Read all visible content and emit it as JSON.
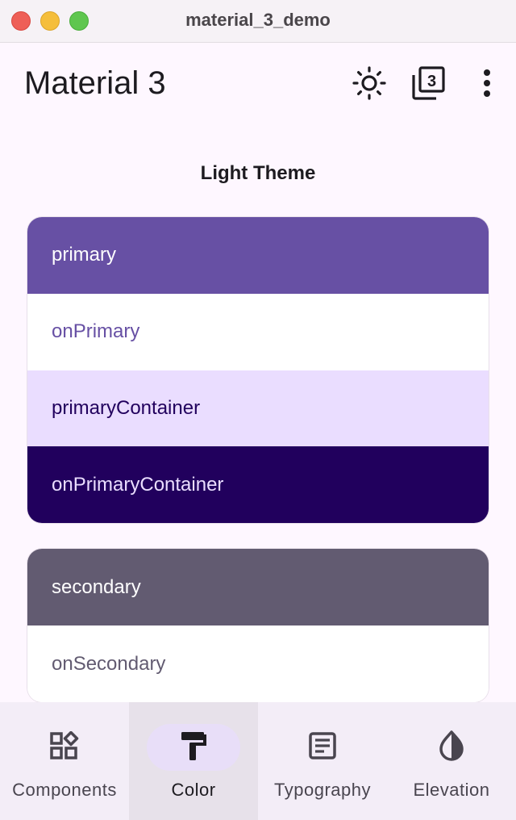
{
  "window": {
    "title": "material_3_demo"
  },
  "appbar": {
    "title": "Material 3",
    "actions": [
      {
        "icon": "brightness-icon"
      },
      {
        "icon": "material-3-badge-icon",
        "badge": "3"
      },
      {
        "icon": "more-vert-icon"
      }
    ]
  },
  "content": {
    "section_title": "Light Theme",
    "primary_group": [
      {
        "label": "primary",
        "bg": "#6750a4",
        "fg": "#ffffff"
      },
      {
        "label": "onPrimary",
        "bg": "#ffffff",
        "fg": "#6750a4"
      },
      {
        "label": "primaryContainer",
        "bg": "#eaddff",
        "fg": "#21005d"
      },
      {
        "label": "onPrimaryContainer",
        "bg": "#21005d",
        "fg": "#eaddff"
      }
    ],
    "secondary_group": [
      {
        "label": "secondary",
        "bg": "#625b71",
        "fg": "#ffffff"
      },
      {
        "label": "onSecondary",
        "bg": "#ffffff",
        "fg": "#625b71"
      }
    ]
  },
  "bottomnav": {
    "items": [
      {
        "label": "Components",
        "icon": "widgets-icon"
      },
      {
        "label": "Color",
        "icon": "format-paint-icon",
        "selected": true
      },
      {
        "label": "Typography",
        "icon": "article-icon"
      },
      {
        "label": "Elevation",
        "icon": "opacity-icon"
      }
    ]
  },
  "colors": {
    "background": "#fef7ff",
    "nav_background": "#f3edf7",
    "nav_indicator": "#e8def8",
    "on_surface": "#1d1b20"
  }
}
